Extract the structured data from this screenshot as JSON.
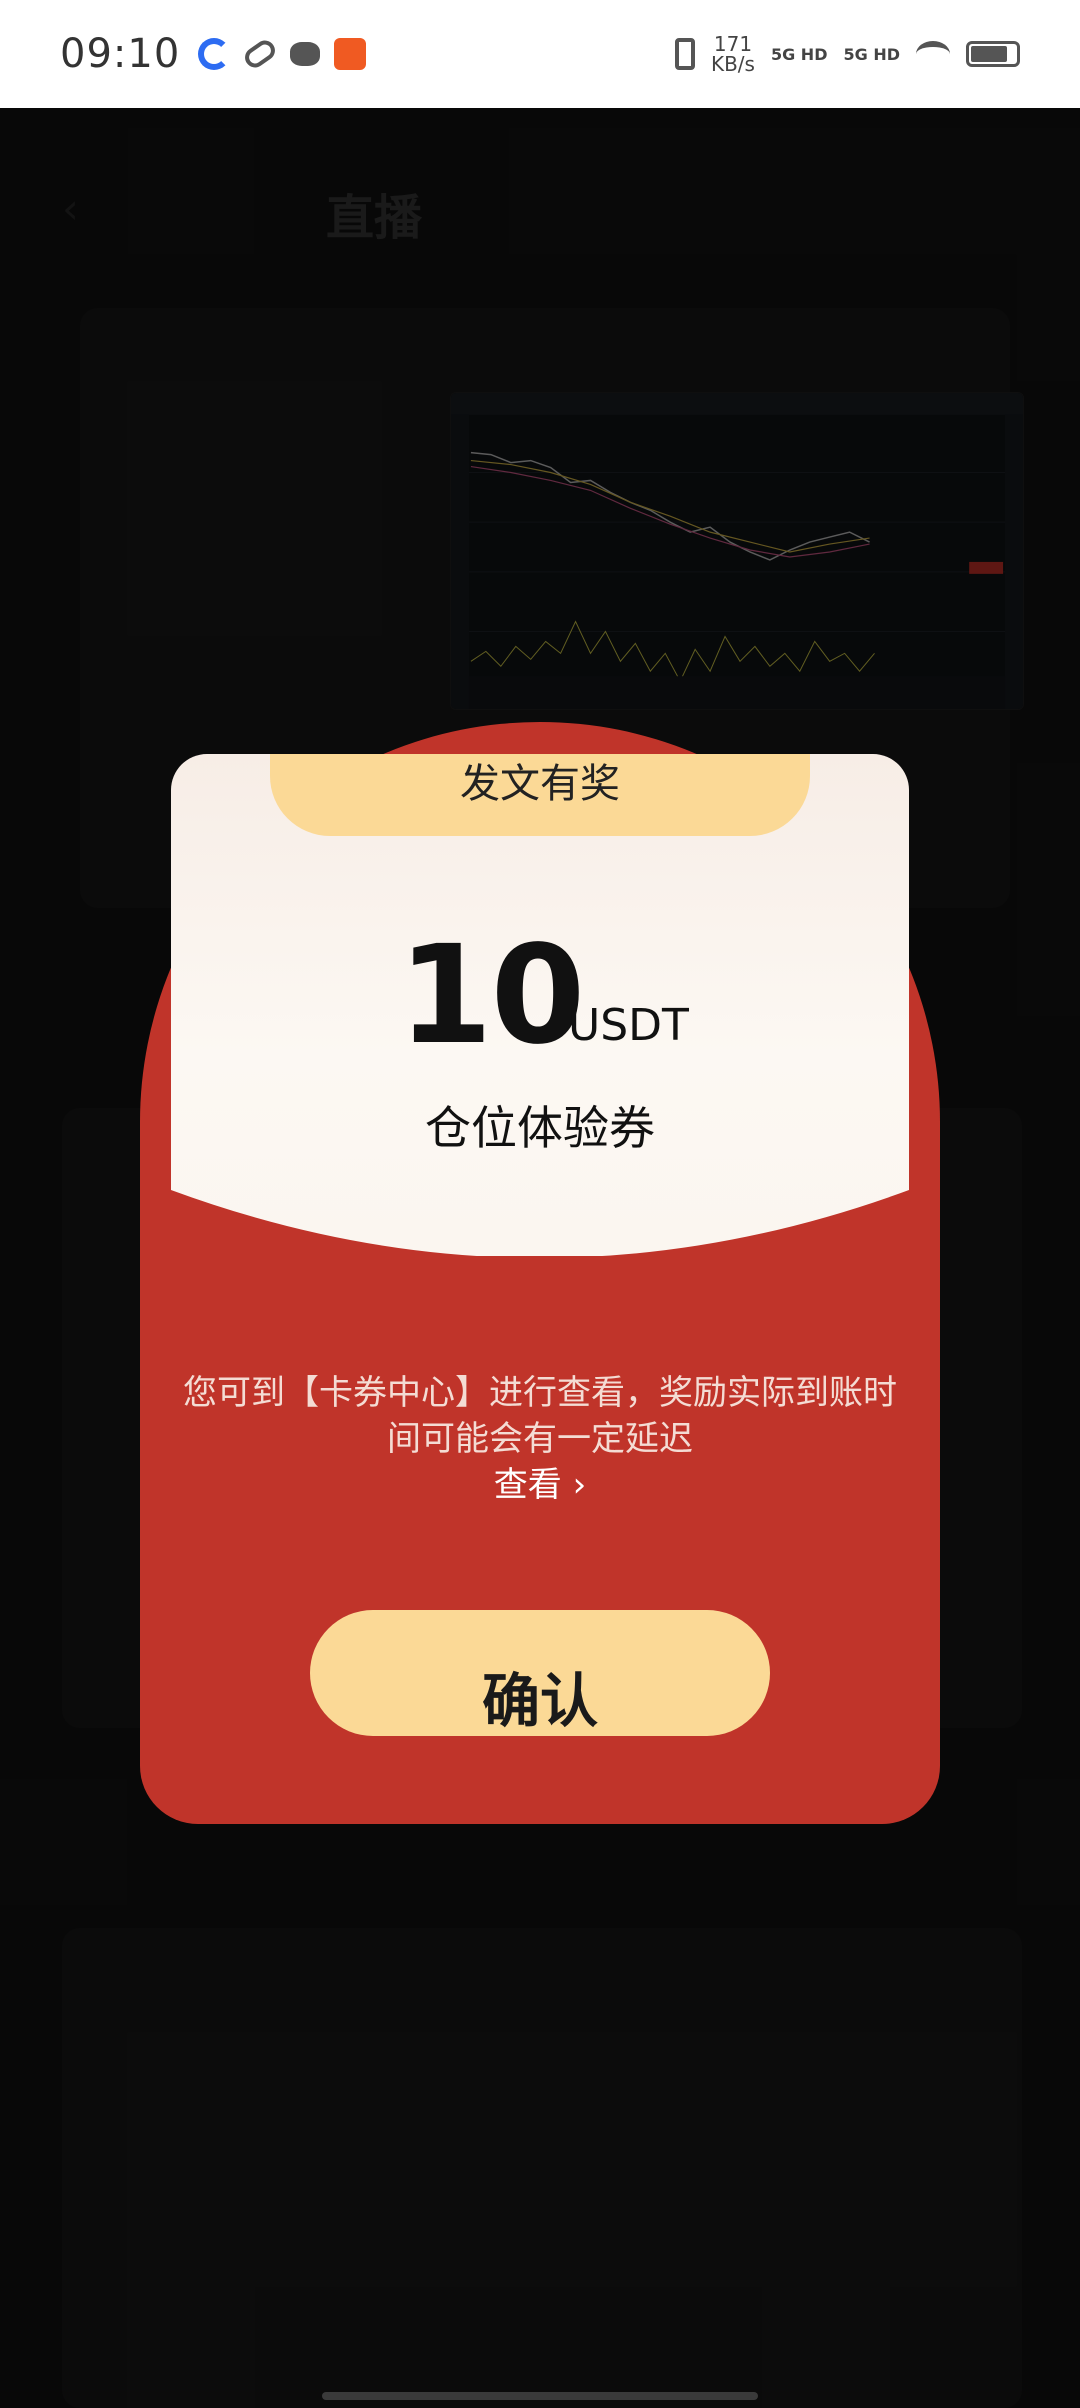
{
  "status_bar": {
    "time": "09:10",
    "net_speed_value": "171",
    "net_speed_unit": "KB/s",
    "signal_1": "5G HD",
    "signal_2": "5G HD"
  },
  "background": {
    "nav_back_icon": "chevron-left-icon",
    "nav_active_tab": "直播"
  },
  "modal": {
    "ribbon_title": "发文有奖",
    "amount": "10",
    "unit": "USDT",
    "coupon_name": "仓位体验券",
    "description": "您可到【卡券中心】进行查看，奖励实际到账时间可能会有一定延迟",
    "view_label": "查看 ›",
    "confirm_label": "确认",
    "colors": {
      "red": "#c0342a",
      "gold": "#fbd996",
      "card": "#fbf6f0"
    }
  }
}
